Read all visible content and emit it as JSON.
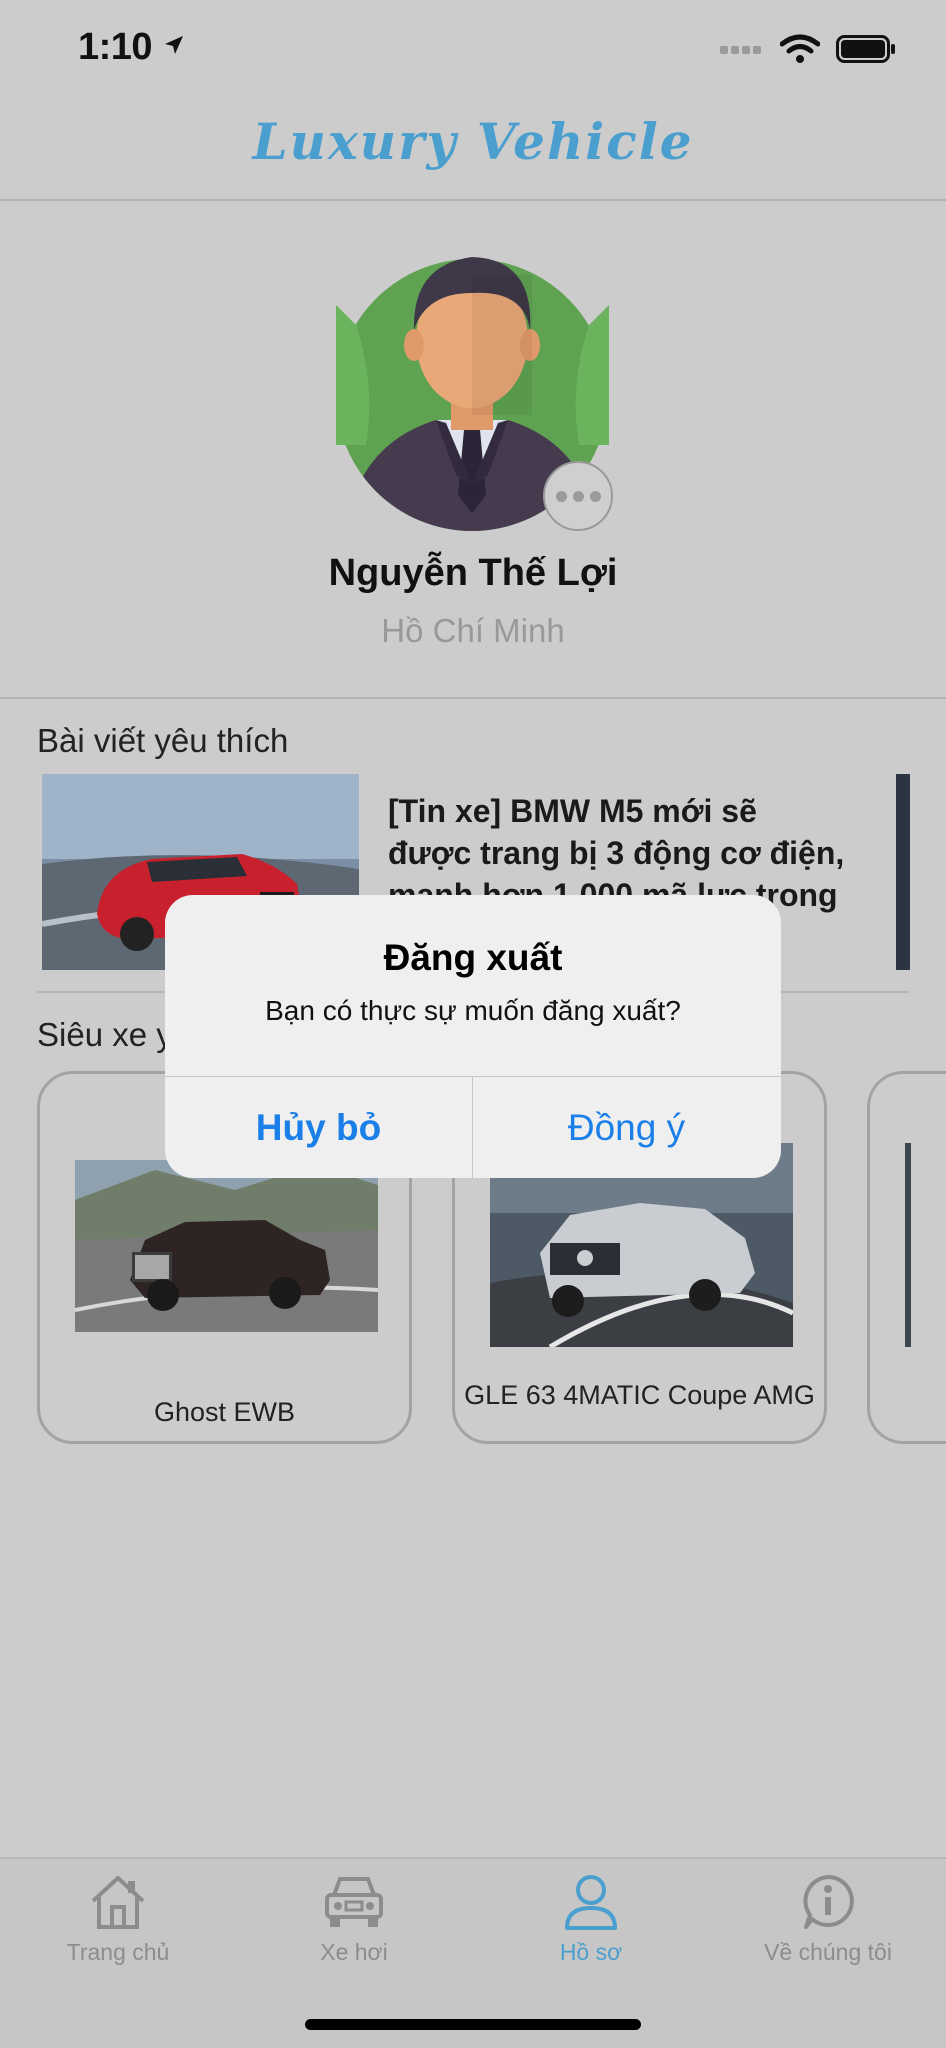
{
  "status_bar": {
    "time": "1:10"
  },
  "header": {
    "app_title": "Luxury Vehicle"
  },
  "profile": {
    "name": "Nguyễn Thế Lợi",
    "city": "Hồ Chí Minh"
  },
  "favorites": {
    "section_title": "Bài viết yêu thích",
    "post_title": "[Tin xe] BMW M5 mới sẽ được trang bị 3 động cơ điện, mạnh hơn 1.000 mã lực trong năm 2023."
  },
  "supercars": {
    "section_title": "Siêu xe yêu thích",
    "cars": [
      {
        "name": "Ghost EWB"
      },
      {
        "name": "GLE 63 4MATIC Coupe AMG"
      }
    ]
  },
  "dialog": {
    "title": "Đăng xuất",
    "message": "Bạn có thực sự muốn đăng xuất?",
    "cancel_label": "Hủy bỏ",
    "confirm_label": "Đồng ý"
  },
  "tabbar": {
    "tabs": [
      {
        "label": "Trang chủ",
        "icon": "house-icon"
      },
      {
        "label": "Xe hơi",
        "icon": "car-icon"
      },
      {
        "label": "Hồ sơ",
        "icon": "person-icon",
        "active": true
      },
      {
        "label": "Về chúng tôi",
        "icon": "info-icon"
      }
    ]
  },
  "colors": {
    "accent": "#4a9fcf",
    "dialog_button": "#1a7fe8",
    "background": "#cccccc"
  }
}
